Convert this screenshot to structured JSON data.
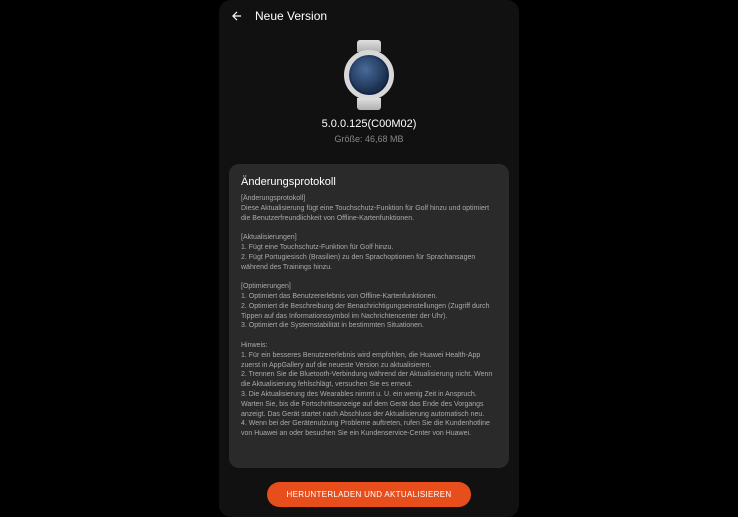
{
  "header": {
    "title": "Neue Version"
  },
  "device": {
    "version": "5.0.0.125(C00M02)",
    "size_label": "Größe: 46,68 MB"
  },
  "changelog": {
    "title": "Änderungsprotokoll",
    "body": "[Änderungsprotokoll]\nDiese Aktualisierung fügt eine Touchschutz-Funktion für Golf hinzu und optimiert die Benutzerfreundlichkeit von Offline-Kartenfunktionen.\n\n[Aktualisierungen]\n1. Fügt eine Touchschutz-Funktion für Golf hinzu.\n2. Fügt Portugiesisch (Brasilien) zu den Sprachoptionen für Sprachansagen während des Trainings hinzu.\n\n[Optimierungen]\n1. Optimiert das Benutzererlebnis von Offline-Kartenfunktionen.\n2. Optimiert die Beschreibung der Benachrichtigungseinstellungen (Zugriff durch Tippen auf das Informationssymbol im Nachrichtencenter der Uhr).\n3. Optimiert die Systemstabilität in bestimmten Situationen.\n\nHinweis:\n1. Für ein besseres Benutzererlebnis wird empfohlen, die Huawei Health-App zuerst in AppGallery auf die neueste Version zu aktualisieren.\n2. Trennen Sie die Bluetooth-Verbindung während der Aktualisierung nicht. Wenn die Aktualisierung fehlschlägt, versuchen Sie es erneut.\n3. Die Aktualisierung des Wearables nimmt u. U. ein wenig Zeit in Anspruch. Warten Sie, bis die Fortschrittsanzeige auf dem Gerät das Ende des Vorgangs anzeigt. Das Gerät startet nach Abschluss der Aktualisierung automatisch neu.\n4. Wenn bei der Gerätenutzung Probleme auftreten, rufen Sie die Kundenhotline von Huawei an oder besuchen Sie ein Kundenservice-Center von Huawei."
  },
  "action": {
    "button_label": "HERUNTERLADEN UND AKTUALISIEREN"
  }
}
